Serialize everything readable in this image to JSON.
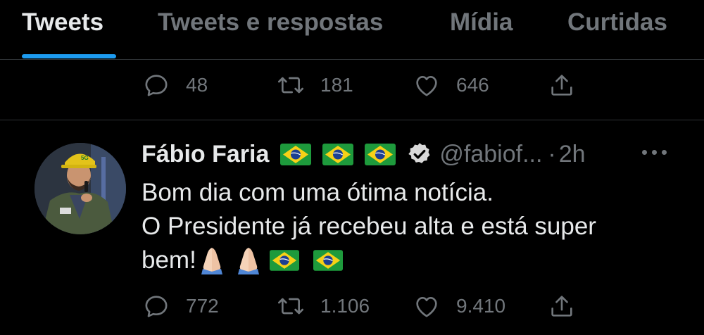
{
  "tabs": [
    {
      "label": "Tweets"
    },
    {
      "label": "Tweets e respostas"
    },
    {
      "label": "Mídia"
    },
    {
      "label": "Curtidas"
    }
  ],
  "prev_tweet": {
    "replies": "48",
    "retweets": "181",
    "likes": "646"
  },
  "tweet": {
    "name": "Fábio Faria",
    "handle": "@fabiof...",
    "separator": "·",
    "time": "2h",
    "text_line1": "Bom dia com uma ótima notícia.",
    "text_line2": "O Presidente já recebeu alta e está super",
    "text_line3": "bem!",
    "replies": "772",
    "retweets": "1.106",
    "likes": "9.410"
  },
  "icons": {
    "reply": "reply-icon",
    "retweet": "retweet-icon",
    "like": "heart-icon",
    "share": "share-icon",
    "verified": "verified-badge-icon",
    "more": "more-icon"
  },
  "colors": {
    "accent": "#1d9bf0",
    "muted": "#71767b",
    "text": "#e7e9ea",
    "background": "#000000"
  }
}
